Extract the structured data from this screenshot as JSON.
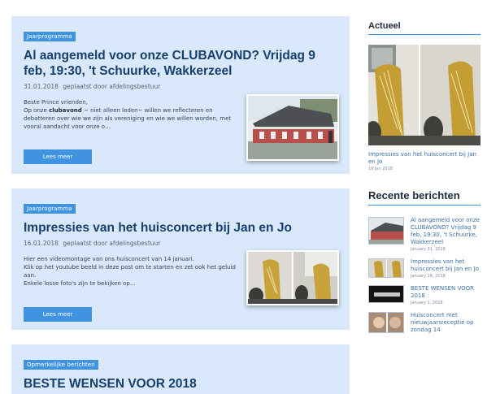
{
  "posts": [
    {
      "category": "Jaarprogramma",
      "title": "Al aangemeld voor onze CLUBAVOND? Vrijdag 9 feb, 19:30, 't Schuurke, Wakkerzeel",
      "date": "31.01.2018",
      "meta_text": "geplaatst door afdelingsbestuur",
      "excerpt_1": "Beste Prince vrienden,",
      "excerpt_2a": "Op onze ",
      "excerpt_2b": "clubavond",
      "excerpt_2c": " ~ niet alleen leden~ willen we reflecteren en debatteren over wie we zijn als vereniging en wie we willen worden, met vooral aandacht voor onze o…",
      "readmore": "Lees meer"
    },
    {
      "category": "Jaarprogramma",
      "title": "Impressies van het huisconcert bij Jan en Jo",
      "date": "16.01.2018",
      "meta_text": "geplaatst door afdelingsbestuur",
      "excerpt_1": "Hier een videomontage van ons huisconcert van 14 januari.",
      "excerpt_2": "Klik op het youtube beeld in deze post om te starten en zet ook het geluid aan.",
      "excerpt_3": "Enkele losse foto's zijn te bekijken op…",
      "readmore": "Lees meer"
    },
    {
      "category": "Opmerkelijke berichten",
      "title": "BESTE WENSEN VOOR 2018"
    }
  ],
  "sidebar": {
    "actueel": {
      "heading": "Actueel",
      "caption": "Impressies van het huisconcert bij Jan en Jo",
      "date": "16 Jan 2018"
    },
    "recent": {
      "heading": "Recente berichten",
      "items": [
        {
          "title": "Al aangemeld voor onze CLUBAVOND? Vrijdag 9 feb, 19:30, 't Schuurke, Wakkerzeel",
          "date": "January 31, 2018"
        },
        {
          "title": "Impressies van het huisconcert bij Jan en Jo",
          "date": "January 16, 2018"
        },
        {
          "title": "BESTE WENSEN VOOR 2018",
          "date": "January 1, 2018"
        },
        {
          "title": "Huisconcert met nieuwjaarsreceptie op zondag 14",
          "date": ""
        }
      ]
    }
  }
}
